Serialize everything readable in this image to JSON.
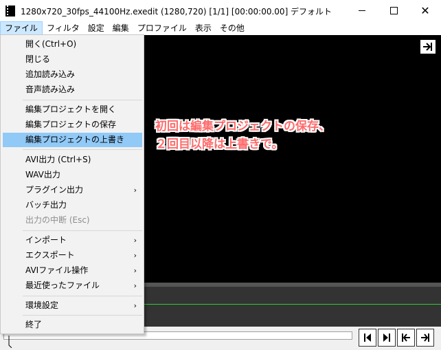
{
  "window": {
    "title": "1280x720_30fps_44100Hz.exedit (1280,720)  [1/1] [00:00:00.00]  デフォルト",
    "close_glyph": "✕"
  },
  "menubar": {
    "items": [
      "ファイル",
      "フィルタ",
      "設定",
      "編集",
      "プロファイル",
      "表示",
      "その他"
    ]
  },
  "file_menu": {
    "items": [
      {
        "label": "開く(Ctrl+O)",
        "has_submenu": false,
        "highlighted": false,
        "disabled": false
      },
      {
        "label": "閉じる",
        "has_submenu": false,
        "highlighted": false,
        "disabled": false
      },
      {
        "label": "追加読み込み",
        "has_submenu": false,
        "highlighted": false,
        "disabled": false
      },
      {
        "label": "音声読み込み",
        "has_submenu": false,
        "highlighted": false,
        "disabled": false
      },
      {
        "label": "編集プロジェクトを開く",
        "has_submenu": false,
        "highlighted": false,
        "disabled": false
      },
      {
        "label": "編集プロジェクトの保存",
        "has_submenu": false,
        "highlighted": false,
        "disabled": false
      },
      {
        "label": "編集プロジェクトの上書き",
        "has_submenu": false,
        "highlighted": true,
        "disabled": false
      },
      {
        "label": "AVI出力 (Ctrl+S)",
        "has_submenu": false,
        "highlighted": false,
        "disabled": false
      },
      {
        "label": "WAV出力",
        "has_submenu": false,
        "highlighted": false,
        "disabled": false
      },
      {
        "label": "プラグイン出力",
        "has_submenu": true,
        "highlighted": false,
        "disabled": false
      },
      {
        "label": "バッチ出力",
        "has_submenu": false,
        "highlighted": false,
        "disabled": false
      },
      {
        "label": "出力の中断 (Esc)",
        "has_submenu": false,
        "highlighted": false,
        "disabled": true
      },
      {
        "label": "インポート",
        "has_submenu": true,
        "highlighted": false,
        "disabled": false
      },
      {
        "label": "エクスポート",
        "has_submenu": true,
        "highlighted": false,
        "disabled": false
      },
      {
        "label": "AVIファイル操作",
        "has_submenu": true,
        "highlighted": false,
        "disabled": false
      },
      {
        "label": "最近使ったファイル",
        "has_submenu": true,
        "highlighted": false,
        "disabled": false
      },
      {
        "label": "環境設定",
        "has_submenu": true,
        "highlighted": false,
        "disabled": false
      },
      {
        "label": "終了",
        "has_submenu": false,
        "highlighted": false,
        "disabled": false
      }
    ],
    "submenu_arrow": "›"
  },
  "annotation": {
    "line1": "初回は編集プロジェクトの保存、",
    "line2": "２回目以降は上書きで。",
    "color": "#ff6b6b"
  },
  "colors": {
    "menu_highlight": "#91c9f7",
    "active_menu": "#cce8ff",
    "preview_bg": "#000000",
    "timeline_bg": "#333333",
    "audio_line": "#33cc33"
  },
  "icons": {
    "jump_end": "jump-to-end-icon",
    "prev_frame": "previous-frame-icon",
    "next_frame": "next-frame-icon",
    "jump_start": "jump-to-start-icon"
  }
}
